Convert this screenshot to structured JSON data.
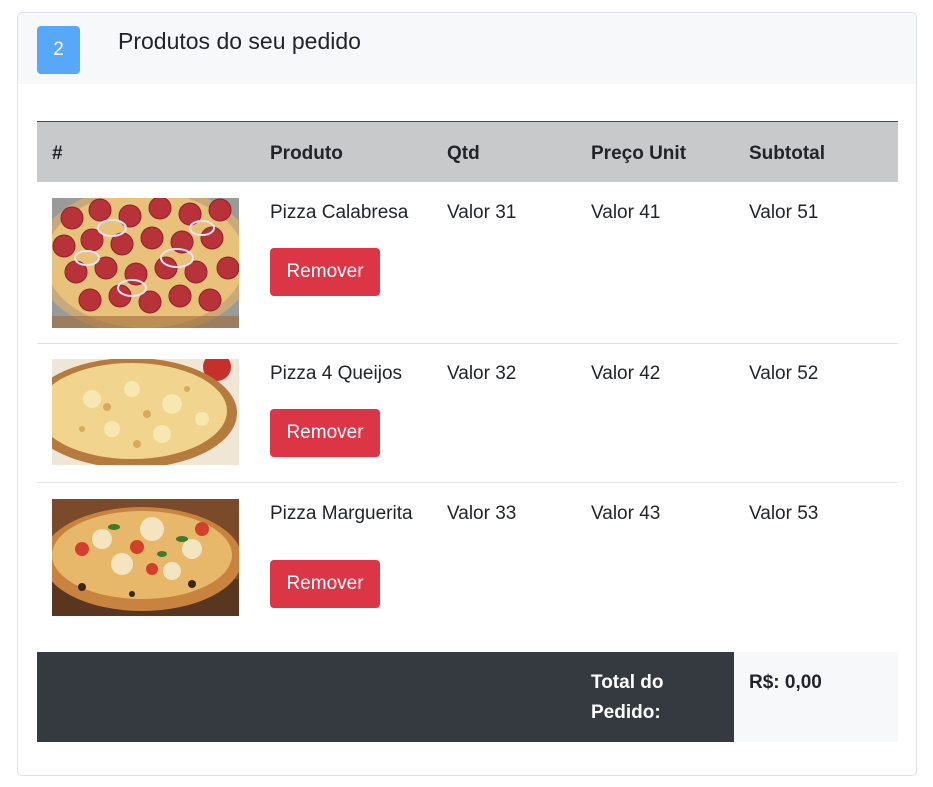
{
  "header": {
    "step_number": "2",
    "title": "Produtos do seu pedido"
  },
  "table": {
    "columns": [
      "#",
      "Produto",
      "Qtd",
      "Preço Unit",
      "Subtotal"
    ],
    "rows": [
      {
        "image": "pizza-calabresa-image",
        "product": "Pizza Calabresa",
        "qty": "Valor 31",
        "unit_price": "Valor 41",
        "subtotal": "Valor 51",
        "remove_label": "Remover"
      },
      {
        "image": "pizza-4-queijos-image",
        "product": "Pizza 4 Queijos",
        "qty": "Valor 32",
        "unit_price": "Valor 42",
        "subtotal": "Valor 52",
        "remove_label": "Remover"
      },
      {
        "image": "pizza-marguerita-image",
        "product": "Pizza Marguerita",
        "qty": "Valor 33",
        "unit_price": "Valor 43",
        "subtotal": "Valor 53",
        "remove_label": "Remover"
      }
    ],
    "footer": {
      "total_label": "Total do Pedido:",
      "total_value": "R$: 0,00"
    }
  },
  "colors": {
    "badge": "#58a8f9",
    "remove_button": "#dc3545",
    "footer_dark": "#343a40",
    "table_header": "#c8c9cb"
  }
}
